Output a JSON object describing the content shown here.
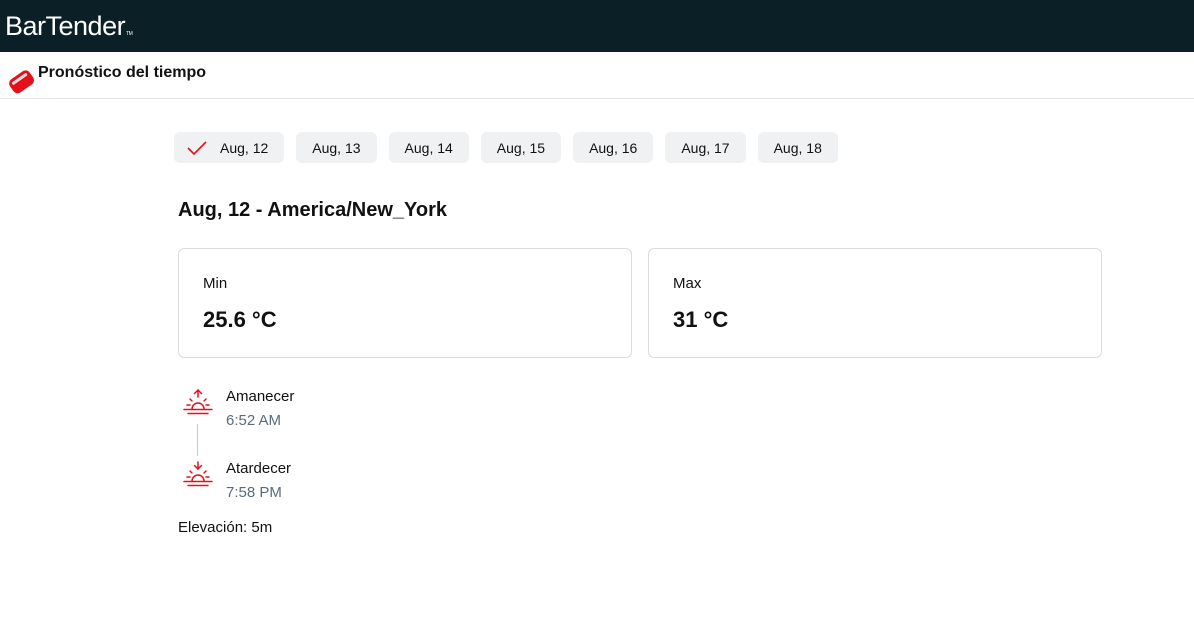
{
  "app": {
    "brand": "BarTender",
    "brand_tm": "TM",
    "title": "Pronóstico del tiempo"
  },
  "tabs": [
    {
      "label": "Aug, 12",
      "active": true
    },
    {
      "label": "Aug, 13",
      "active": false
    },
    {
      "label": "Aug, 14",
      "active": false
    },
    {
      "label": "Aug, 15",
      "active": false
    },
    {
      "label": "Aug, 16",
      "active": false
    },
    {
      "label": "Aug, 17",
      "active": false
    },
    {
      "label": "Aug, 18",
      "active": false
    }
  ],
  "forecast": {
    "heading": "Aug, 12 - America/New_York",
    "min": {
      "label": "Min",
      "value": "25.6 °C"
    },
    "max": {
      "label": "Max",
      "value": "31 °C"
    },
    "sunrise": {
      "label": "Amanecer",
      "time": "6:52 AM",
      "icon": "sunrise-icon"
    },
    "sunset": {
      "label": "Atardecer",
      "time": "7:58 PM",
      "icon": "sunset-icon"
    },
    "elevation": "Elevación: 5m"
  },
  "colors": {
    "topbar": "#0b1f27",
    "accent": "#e3111b",
    "muted_text": "#5a6b7b",
    "tab_bg": "#f0f1f3"
  }
}
